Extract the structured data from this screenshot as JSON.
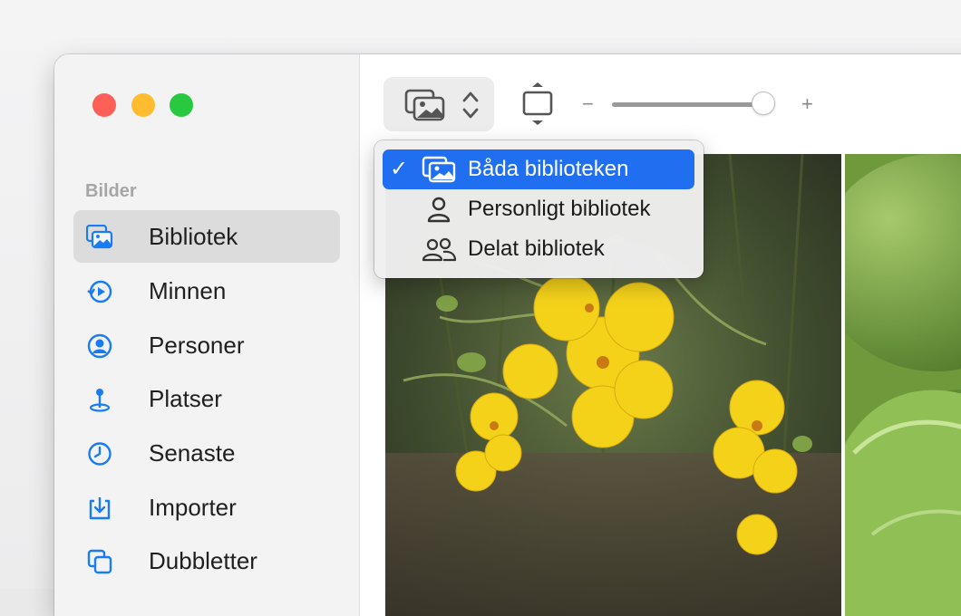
{
  "window": {
    "traffic_lights": {
      "close_color": "#fe5f57",
      "minimize_color": "#febc2e",
      "zoom_color": "#28c840"
    }
  },
  "sidebar": {
    "section_title": "Bilder",
    "items": [
      {
        "label": "Bibliotek",
        "icon": "library-icon",
        "selected": true
      },
      {
        "label": "Minnen",
        "icon": "memories-icon",
        "selected": false
      },
      {
        "label": "Personer",
        "icon": "person-icon",
        "selected": false
      },
      {
        "label": "Platser",
        "icon": "pin-icon",
        "selected": false
      },
      {
        "label": "Senaste",
        "icon": "clock-icon",
        "selected": false
      },
      {
        "label": "Importer",
        "icon": "import-icon",
        "selected": false
      },
      {
        "label": "Dubbletter",
        "icon": "duplicates-icon",
        "selected": false
      }
    ]
  },
  "toolbar": {
    "library_picker_icon": "library-icon",
    "chevron_icon": "up-down-chevron-icon",
    "fit_icon": "fit-vertical-icon",
    "zoom_minus": "−",
    "zoom_plus": "+",
    "zoom_level": 0.93
  },
  "library_menu": {
    "items": [
      {
        "label": "Båda biblioteken",
        "icon": "library-icon",
        "checked": true
      },
      {
        "label": "Personligt bibliotek",
        "icon": "person-outline-icon",
        "checked": false
      },
      {
        "label": "Delat bibliotek",
        "icon": "two-people-icon",
        "checked": false
      }
    ],
    "check_mark": "✓"
  },
  "colors": {
    "accent": "#1f6ff0",
    "sidebar_icon": "#1a7cf5",
    "selection_bg": "#dcdcdc"
  }
}
